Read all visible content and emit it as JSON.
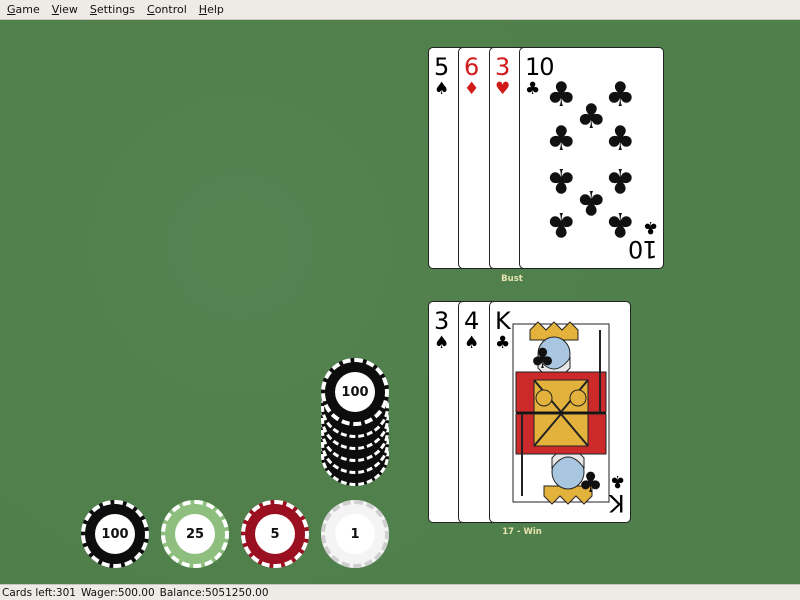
{
  "menu": [
    {
      "label": "Game",
      "mnemonic": "G",
      "rest": "ame"
    },
    {
      "label": "View",
      "mnemonic": "V",
      "rest": "iew"
    },
    {
      "label": "Settings",
      "mnemonic": "S",
      "rest": "ettings"
    },
    {
      "label": "Control",
      "mnemonic": "C",
      "rest": "ontrol"
    },
    {
      "label": "Help",
      "mnemonic": "H",
      "rest": "elp"
    }
  ],
  "dealer_hand": {
    "cards": [
      {
        "rank": "5",
        "suit": "♠",
        "color": "black"
      },
      {
        "rank": "6",
        "suit": "♦",
        "color": "red"
      },
      {
        "rank": "3",
        "suit": "♥",
        "color": "red"
      },
      {
        "rank": "10",
        "suit": "♣",
        "color": "black"
      }
    ],
    "status": "Bust"
  },
  "player_hand": {
    "cards": [
      {
        "rank": "3",
        "suit": "♠",
        "color": "black"
      },
      {
        "rank": "4",
        "suit": "♠",
        "color": "black"
      },
      {
        "rank": "K",
        "suit": "♣",
        "color": "black"
      }
    ],
    "status": "17 - Win"
  },
  "bet_stack": {
    "top_value": "100",
    "count": 6
  },
  "chips": [
    {
      "value": "100",
      "color": "#0d0d0d"
    },
    {
      "value": "25",
      "color": "#8fbf7f"
    },
    {
      "value": "5",
      "color": "#9b1020"
    },
    {
      "value": "1",
      "color": "#f4f4f4"
    }
  ],
  "status": {
    "cards_left": "Cards left:301",
    "wager": "Wager:500.00",
    "balance": "Balance:5051250.00"
  }
}
